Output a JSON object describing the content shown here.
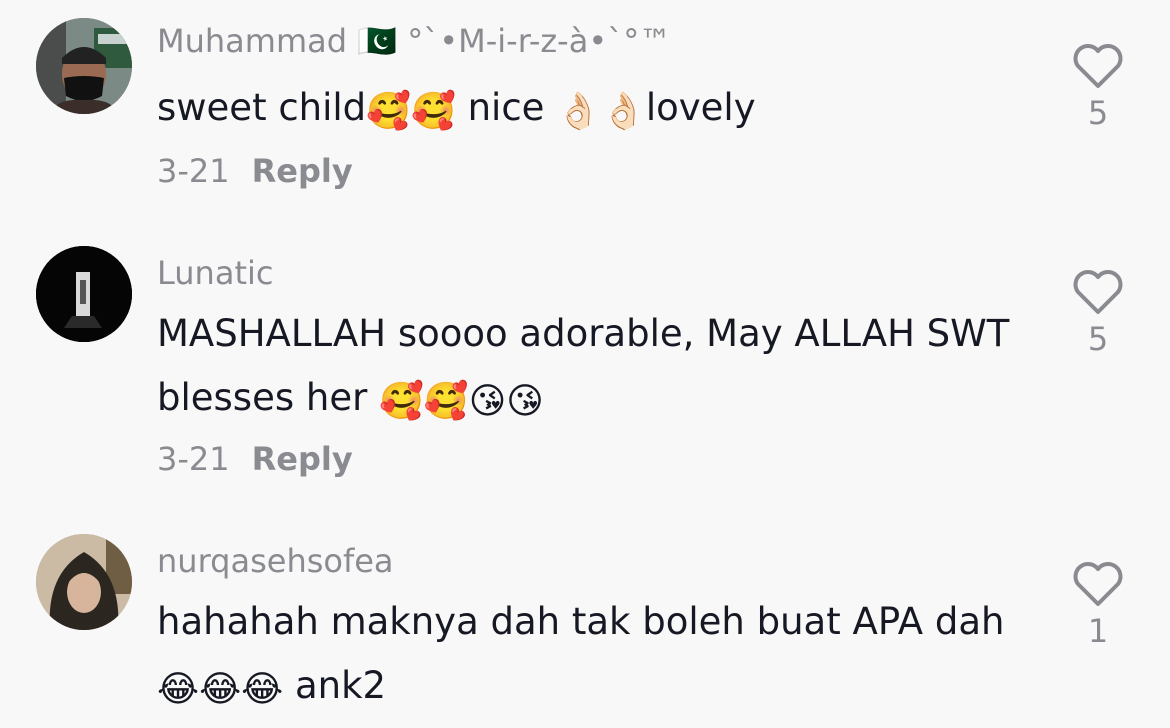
{
  "comments": [
    {
      "author": "Muhammad 🇵🇰 °`•M-i-r-z-à•`°™",
      "text_parts": [
        "sweet child",
        "🥰🥰",
        " nice ",
        "👌🏻👌🏻",
        "lovely"
      ],
      "date": "3-21",
      "reply_label": "Reply",
      "likes": "5",
      "avatar_icon": "man-wearing-mask-avatar"
    },
    {
      "author": "Lunatic",
      "text_parts": [
        "MASHALLAH soooo adorable, May ALLAH SWT blesses her ",
        "🥰🥰😘😘"
      ],
      "date": "3-21",
      "reply_label": "Reply",
      "likes": "5",
      "avatar_icon": "dark-doorway-avatar"
    },
    {
      "author": "nurqasehsofea",
      "text_parts": [
        "hahahah maknya dah tak boleh buat APA dah ",
        "😂😂😂",
        " ank2"
      ],
      "date": "",
      "reply_label": "",
      "likes": "1",
      "avatar_icon": "woman-in-hijab-avatar"
    }
  ]
}
